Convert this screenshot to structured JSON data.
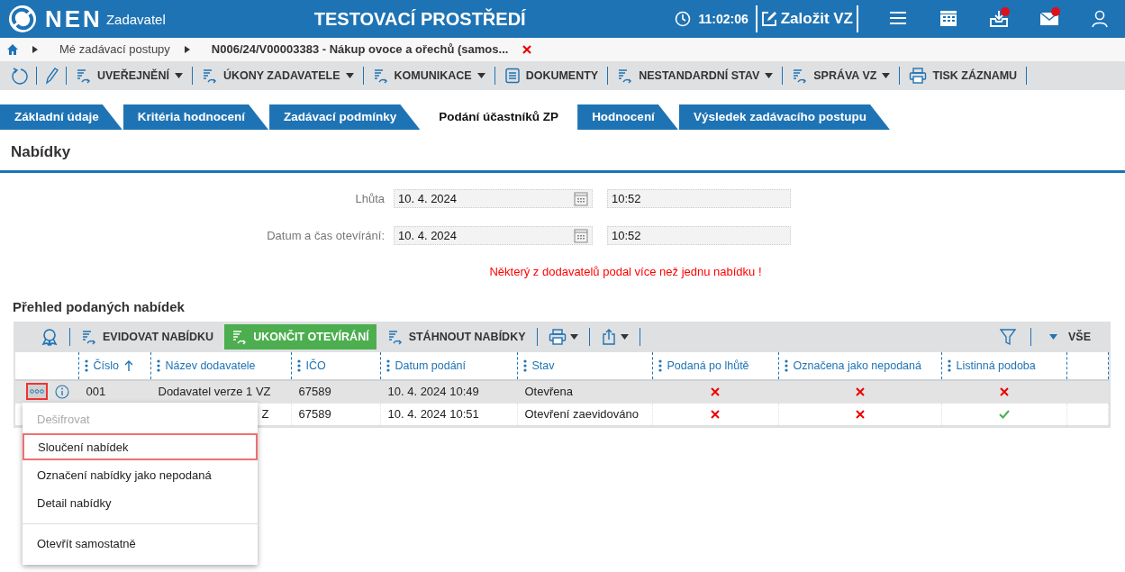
{
  "header": {
    "logo": "NEN",
    "subtitle": "Zadavatel",
    "title": "TESTOVACÍ PROSTŘEDÍ",
    "time": "11:02:06",
    "create_label": "Založit VZ",
    "icons": [
      {
        "kind": "menu",
        "badge": false
      },
      {
        "kind": "calendar",
        "badge": false
      },
      {
        "kind": "inbox",
        "badge": true
      },
      {
        "kind": "mail",
        "badge": true
      },
      {
        "kind": "user",
        "badge": false
      }
    ]
  },
  "breadcrumb": {
    "items": [
      "Mé zadávací postupy",
      "N006/24/V00003383 - Nákup ovoce a ořechů (samos..."
    ]
  },
  "toolbar": [
    {
      "kind": "refresh"
    },
    {
      "kind": "edit"
    },
    {
      "kind": "action",
      "label": "UVEŘEJNĚNÍ",
      "dropdown": true
    },
    {
      "kind": "action",
      "label": "ÚKONY ZADAVATELE",
      "dropdown": true
    },
    {
      "kind": "action",
      "label": "KOMUNIKACE",
      "dropdown": true
    },
    {
      "kind": "document",
      "label": "DOKUMENTY",
      "dropdown": false
    },
    {
      "kind": "action",
      "label": "NESTANDARDNÍ STAV",
      "dropdown": true
    },
    {
      "kind": "action",
      "label": "SPRÁVA VZ",
      "dropdown": true
    },
    {
      "kind": "print",
      "label": "TISK ZÁZNAMU",
      "dropdown": false
    }
  ],
  "tabs": [
    {
      "label": "Základní údaje",
      "selected": false
    },
    {
      "label": "Kritéria hodnocení",
      "selected": false
    },
    {
      "label": "Zadávací podmínky",
      "selected": false
    },
    {
      "label": "Podání účastníků ZP",
      "selected": true
    },
    {
      "label": "Hodnocení",
      "selected": false
    },
    {
      "label": "Výsledek zadávacího postupu",
      "selected": false
    }
  ],
  "section_title": "Nabídky",
  "form": [
    {
      "label": "Lhůta",
      "date": "10. 4. 2024",
      "time": "10:52"
    },
    {
      "label": "Datum a čas otevírání:",
      "date": "10. 4. 2024",
      "time": "10:52"
    }
  ],
  "warning": "Některý z dodavatelů podal více než jednu nabídku !",
  "grid": {
    "title": "Přehled podaných nabídek",
    "toolbar": [
      {
        "kind": "award"
      },
      {
        "kind": "action",
        "label": "EVIDOVAT NABÍDKU",
        "primary": false
      },
      {
        "kind": "action",
        "label": "UKONČIT OTEVÍRÁNÍ",
        "primary": true
      },
      {
        "kind": "action",
        "label": "STÁHNOUT NABÍDKY",
        "primary": false
      },
      {
        "kind": "print",
        "dropdown": true
      },
      {
        "kind": "export",
        "dropdown": true
      }
    ],
    "filter_label": "VŠE",
    "columns": [
      {
        "label": "Číslo",
        "sorted": true
      },
      {
        "label": "Název dodavatele",
        "sorted": false
      },
      {
        "label": "IČO",
        "sorted": false
      },
      {
        "label": "Datum podání",
        "sorted": false
      },
      {
        "label": "Stav",
        "sorted": false
      },
      {
        "label": "Podaná po lhůtě",
        "sorted": false
      },
      {
        "label": "Označena jako nepodaná",
        "sorted": false
      },
      {
        "label": "Listinná podoba",
        "sorted": false
      }
    ],
    "rows": [
      {
        "selected": true,
        "menu_open": true,
        "number": "001",
        "supplier": "Dodavatel verze 1 VZ",
        "ico": "67589",
        "submitted": "10. 4. 2024 10:49",
        "status": "Otevřena",
        "late": false,
        "not_submitted": false,
        "paper": false
      },
      {
        "selected": false,
        "supplier": "Z",
        "ico": "67589",
        "submitted": "10. 4. 2024 10:51",
        "status": "Otevření zaevidováno",
        "late": false,
        "not_submitted": false,
        "paper": true
      }
    ]
  },
  "context_menu": [
    {
      "label": "Dešifrovat",
      "disabled": true,
      "selected": false,
      "divider_before": false
    },
    {
      "label": "Sloučení nabídek",
      "disabled": false,
      "selected": true,
      "divider_before": false
    },
    {
      "label": "Označení nabídky jako nepodaná",
      "disabled": false,
      "selected": false,
      "divider_before": false
    },
    {
      "label": "Detail nabídky",
      "disabled": false,
      "selected": false,
      "divider_before": false
    },
    {
      "label": "Otevřít samostatně",
      "disabled": false,
      "selected": false,
      "divider_before": true
    }
  ]
}
